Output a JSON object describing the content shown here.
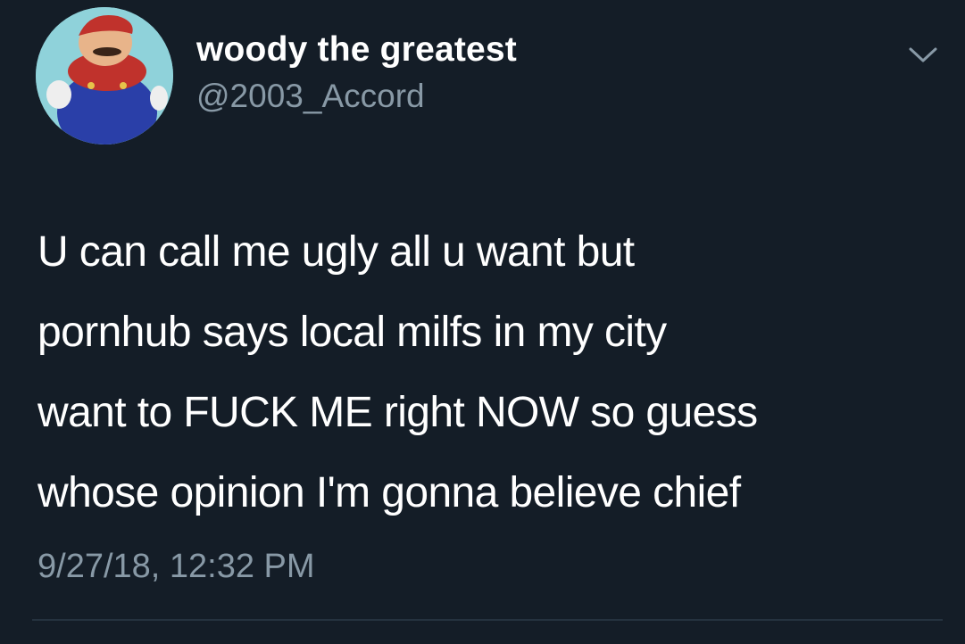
{
  "tweet": {
    "author": {
      "display_name": "woody the greatest",
      "handle": "@2003_Accord",
      "avatar_icon": "avatar-mario-icon"
    },
    "menu_icon": "chevron-down-icon",
    "text_lines": [
      "U can call me ugly all u want but",
      "pornhub says local milfs in my city",
      "want to FUCK ME right NOW so guess",
      "whose opinion I'm gonna believe chief"
    ],
    "timestamp": "9/27/18, 12:32 PM"
  },
  "colors": {
    "background": "#141d27",
    "primary_text": "#ffffff",
    "secondary_text": "#8899a6",
    "divider": "#25323f"
  }
}
